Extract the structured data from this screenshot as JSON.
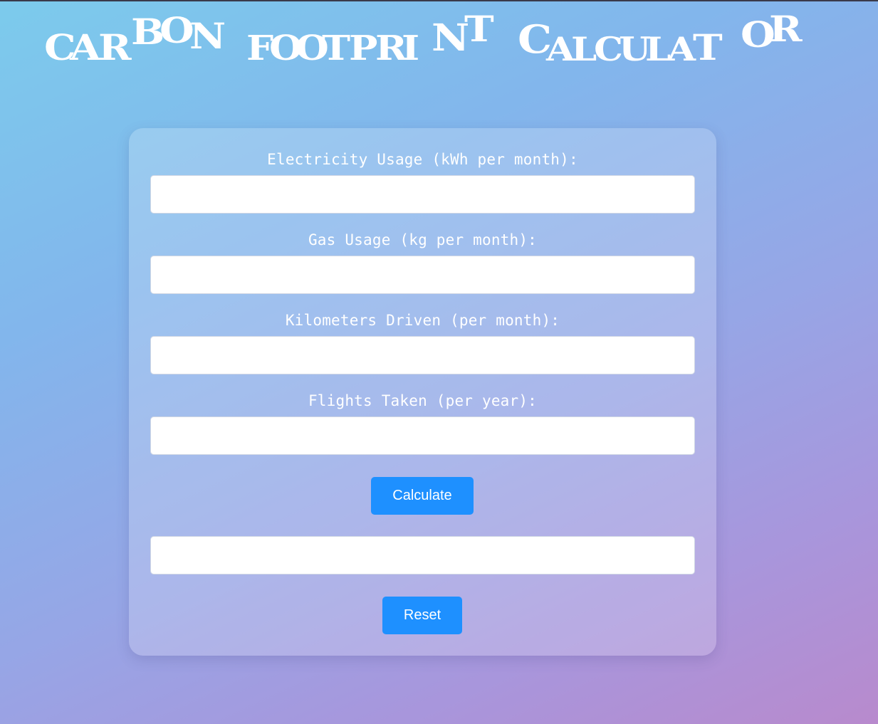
{
  "title": {
    "text": "CARBON FOOTPRINT CALCULATOR",
    "letters": [
      "C",
      "A",
      "R",
      "B",
      "O",
      "N",
      "F",
      "O",
      "O",
      "T",
      "P",
      "R",
      "I",
      "N",
      "T",
      "C",
      "A",
      "L",
      "C",
      "U",
      "L",
      "A",
      "T",
      "O",
      "R"
    ]
  },
  "form": {
    "fields": [
      {
        "label": "Electricity Usage (kWh per month):",
        "value": "",
        "placeholder": ""
      },
      {
        "label": "Gas Usage (kg per month):",
        "value": "",
        "placeholder": ""
      },
      {
        "label": "Kilometers Driven (per month):",
        "value": "",
        "placeholder": ""
      },
      {
        "label": "Flights Taken (per year):",
        "value": "",
        "placeholder": ""
      }
    ],
    "calculate_label": "Calculate",
    "result_value": "",
    "reset_label": "Reset"
  },
  "colors": {
    "button": "#1e90ff",
    "text": "#ffffff"
  }
}
